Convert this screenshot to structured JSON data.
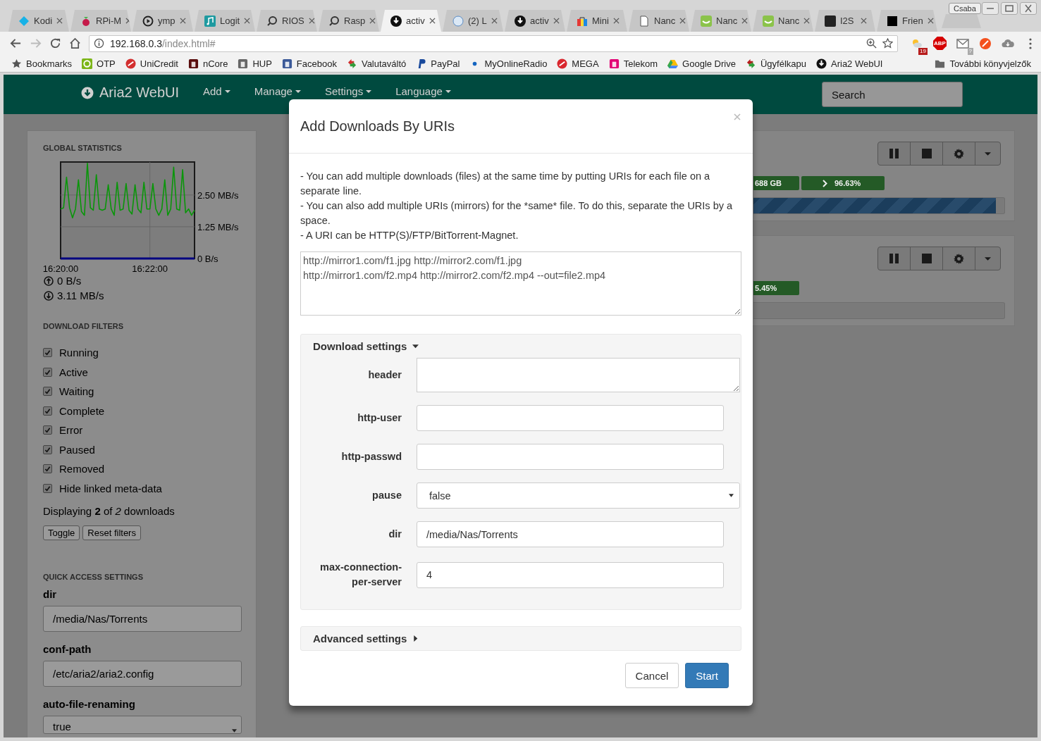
{
  "browser": {
    "tabs": [
      {
        "title": "Kodi",
        "selected": false
      },
      {
        "title": "RPi-M",
        "selected": false
      },
      {
        "title": "ymp",
        "selected": false
      },
      {
        "title": "Logit",
        "selected": false
      },
      {
        "title": "RIOS",
        "selected": false
      },
      {
        "title": "Rasp",
        "selected": false
      },
      {
        "title": "activ",
        "selected": true
      },
      {
        "title": "(2) L",
        "selected": false
      },
      {
        "title": "activ",
        "selected": false
      },
      {
        "title": "Mini",
        "selected": false
      },
      {
        "title": "Nanc",
        "selected": false
      },
      {
        "title": "Nanc",
        "selected": false
      },
      {
        "title": "Nanc",
        "selected": false
      },
      {
        "title": "I2S",
        "selected": false
      },
      {
        "title": "Frien",
        "selected": false
      }
    ],
    "profile": "Csaba",
    "forward_disabled": true,
    "address": {
      "host": "192.168.0.3",
      "path": "/index.html#"
    },
    "extensions": [
      {
        "kind": "weather",
        "badge": "19"
      },
      {
        "kind": "abp",
        "text": "ABP"
      },
      {
        "kind": "mail",
        "badge": "?"
      },
      {
        "kind": "brush"
      },
      {
        "kind": "cloud"
      }
    ],
    "bookmarks": [
      "Bookmarks",
      "OTP",
      "UniCredit",
      "nCore",
      "HUP",
      "Facebook",
      "Valutaváltó",
      "PayPal",
      "MyOnlineRadio",
      "MEGA",
      "Telekom",
      "Google Drive",
      "Ügyfélkapu",
      "Aria2 WebUI"
    ],
    "other_bookmarks": "További könyvjelzők"
  },
  "app": {
    "brand": "Aria2 WebUI",
    "menus": [
      "Add",
      "Manage",
      "Settings",
      "Language"
    ],
    "search": {
      "placeholder": "Search"
    }
  },
  "sidebar": {
    "stats_title": "GLOBAL STATISTICS",
    "chart_data": {
      "type": "line",
      "categories": [
        "16:20:00",
        null,
        null,
        null,
        null,
        null,
        null,
        null,
        null,
        null,
        null,
        null,
        null,
        null,
        null,
        null,
        null,
        null,
        null,
        null,
        null,
        null,
        null,
        null,
        null,
        null,
        null,
        null,
        null,
        null,
        "16:22:00",
        null,
        null,
        null,
        null,
        null,
        null,
        null,
        null,
        null,
        null,
        null,
        null,
        null,
        null,
        null
      ],
      "series": [
        {
          "color": "#0a960a",
          "values": [
            1.95,
            2.0,
            3.2,
            2.0,
            1.6,
            1.95,
            3.1,
            1.85,
            1.7,
            3.75,
            2.0,
            1.9,
            3.3,
            1.95,
            1.9,
            1.95,
            2.9,
            1.95,
            1.7,
            3.0,
            1.9,
            1.95,
            2.95,
            1.9,
            1.75,
            2.9,
            1.95,
            1.8,
            3.0,
            1.95,
            1.95,
            2.95,
            1.95,
            1.7,
            1.95,
            3.1,
            1.7,
            1.95,
            3.6,
            1.95,
            1.9,
            3.5,
            1.8,
            1.95,
            1.7,
            1.9
          ]
        },
        {
          "color": "#000080",
          "values": [
            0,
            0,
            0,
            0,
            0,
            0,
            0,
            0,
            0,
            0,
            0,
            0,
            0,
            0,
            0,
            0,
            0,
            0,
            0,
            0,
            0,
            0,
            0,
            0,
            0,
            0,
            0,
            0,
            0,
            0,
            0,
            0,
            0,
            0,
            0,
            0,
            0,
            0,
            0,
            0,
            0,
            0,
            0,
            0,
            0,
            0
          ]
        }
      ],
      "ylim": [
        0,
        3.8
      ],
      "yticks": [
        {
          "value": 0,
          "label": "0 B/s"
        },
        {
          "value": 1.25,
          "label": "1.25 MB/s"
        },
        {
          "value": 2.5,
          "label": "2.50 MB/s"
        }
      ]
    },
    "upload_speed": "0 B/s",
    "download_speed": "3.11 MB/s",
    "filters_title": "DOWNLOAD FILTERS",
    "filters": [
      {
        "label": "Running",
        "checked": true
      },
      {
        "label": "Active",
        "checked": true
      },
      {
        "label": "Waiting",
        "checked": true
      },
      {
        "label": "Complete",
        "checked": true
      },
      {
        "label": "Error",
        "checked": true
      },
      {
        "label": "Paused",
        "checked": true
      },
      {
        "label": "Removed",
        "checked": true
      },
      {
        "label": "Hide linked meta-data",
        "checked": true
      }
    ],
    "summary": "Displaying **2** of *2* downloads",
    "buttons": [
      "Toggle",
      "Reset filters"
    ],
    "quick_title": "QUICK ACCESS SETTINGS",
    "settings": [
      {
        "kind": "text",
        "label": "dir",
        "value": "/media/Nas/Torrents"
      },
      {
        "kind": "text",
        "label": "conf-path",
        "value": "/etc/aria2/aria2.config"
      },
      {
        "kind": "select",
        "label": "auto-file-renaming",
        "value": "true"
      }
    ]
  },
  "downloads": [
    {
      "badges": [
        {
          "kind": "size",
          "text": "688 GB"
        },
        {
          "kind": "progress",
          "text": "96.63%"
        }
      ],
      "level": 0.9663
    },
    {
      "badges": [
        {
          "kind": "size",
          "text": "5.45%"
        }
      ]
    }
  ],
  "modal": {
    "title": "Add Downloads By URIs",
    "help": [
      "- You can add multiple downloads (files) at the same time by putting URIs for each file on a separate line.",
      "- You can also add multiple URIs (mirrors) for the *same* file. To do this, separate the URIs by a space.",
      "- A URI can be HTTP(S)/FTP/BitTorrent-Magnet."
    ],
    "uris": "http://mirror1.com/f1.jpg http://mirror2.com/f1.jpg\nhttp://mirror1.com/f2.mp4 http://mirror2.com/f2.mp4 --out=file2.mp4",
    "download_settings": {
      "title": "Download settings",
      "expanded": true,
      "fields": [
        {
          "kind": "textarea",
          "label": "header"
        },
        {
          "kind": "text",
          "label": "http-user"
        },
        {
          "kind": "text",
          "label": "http-passwd"
        },
        {
          "kind": "select",
          "label": "pause",
          "value": "false"
        },
        {
          "kind": "text",
          "label": "dir",
          "value": "/media/Nas/Torrents"
        },
        {
          "kind": "text",
          "label": "max-connection-per-server",
          "value": "4"
        }
      ]
    },
    "advanced_settings": {
      "title": "Advanced settings",
      "expanded": false
    },
    "buttons": [
      {
        "kind": "default",
        "label": "Cancel"
      },
      {
        "kind": "primary",
        "label": "Start"
      }
    ]
  }
}
